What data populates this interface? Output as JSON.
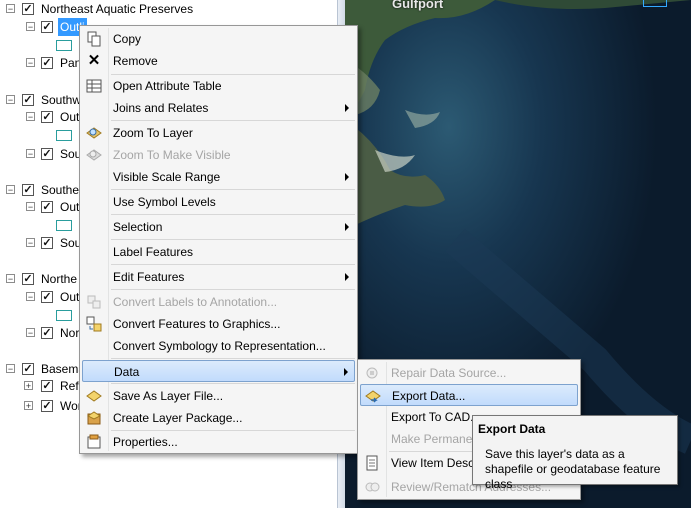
{
  "map": {
    "place_label": "Gulfport"
  },
  "toc": {
    "groups": [
      {
        "name": "Northeast Aquatic Preserves",
        "layers": [
          "Outli",
          "Pan"
        ]
      },
      {
        "name": "Southw",
        "layers": [
          "Out",
          "Sou"
        ]
      },
      {
        "name": "Southe",
        "layers": [
          "Out",
          "Sou"
        ]
      },
      {
        "name": "Northe",
        "layers": [
          "Out",
          "Nor"
        ]
      },
      {
        "name": "Basema",
        "layers": [
          "Refe",
          "Wor"
        ]
      }
    ]
  },
  "context_menu": {
    "items": [
      {
        "label": "Copy",
        "icon": "copy-icon"
      },
      {
        "label": "Remove",
        "icon": "remove-icon"
      },
      {
        "label": "Open Attribute Table",
        "icon": "table-icon"
      },
      {
        "label": "Joins and Relates"
      },
      {
        "label": "Zoom To Layer",
        "icon": "zoom-to-layer-icon"
      },
      {
        "label": "Zoom To Make Visible",
        "icon": "zoom-visible-icon"
      },
      {
        "label": "Visible Scale Range"
      },
      {
        "label": "Use Symbol Levels"
      },
      {
        "label": "Selection"
      },
      {
        "label": "Label Features"
      },
      {
        "label": "Edit Features"
      },
      {
        "label": "Convert Labels to Annotation..."
      },
      {
        "label": "Convert Features to Graphics..."
      },
      {
        "label": "Convert Symbology to Representation..."
      },
      {
        "label": "Data"
      },
      {
        "label": "Save As Layer File..."
      },
      {
        "label": "Create Layer Package..."
      },
      {
        "label": "Properties..."
      }
    ]
  },
  "data_submenu": {
    "items": [
      {
        "label": "Repair Data Source..."
      },
      {
        "label": "Export Data..."
      },
      {
        "label": "Export To CAD..."
      },
      {
        "label": "Make Permane"
      },
      {
        "label": "View Item Desc"
      },
      {
        "label": "Review/Rematch Addresses..."
      }
    ]
  },
  "tooltip": {
    "title": "Export Data",
    "body": "Save this layer's data as a shapefile or geodatabase feature class"
  },
  "colors": {
    "selection": "#3399ff",
    "menu_highlight": "#c1dbfc",
    "ocean": "#0b1b2c"
  }
}
